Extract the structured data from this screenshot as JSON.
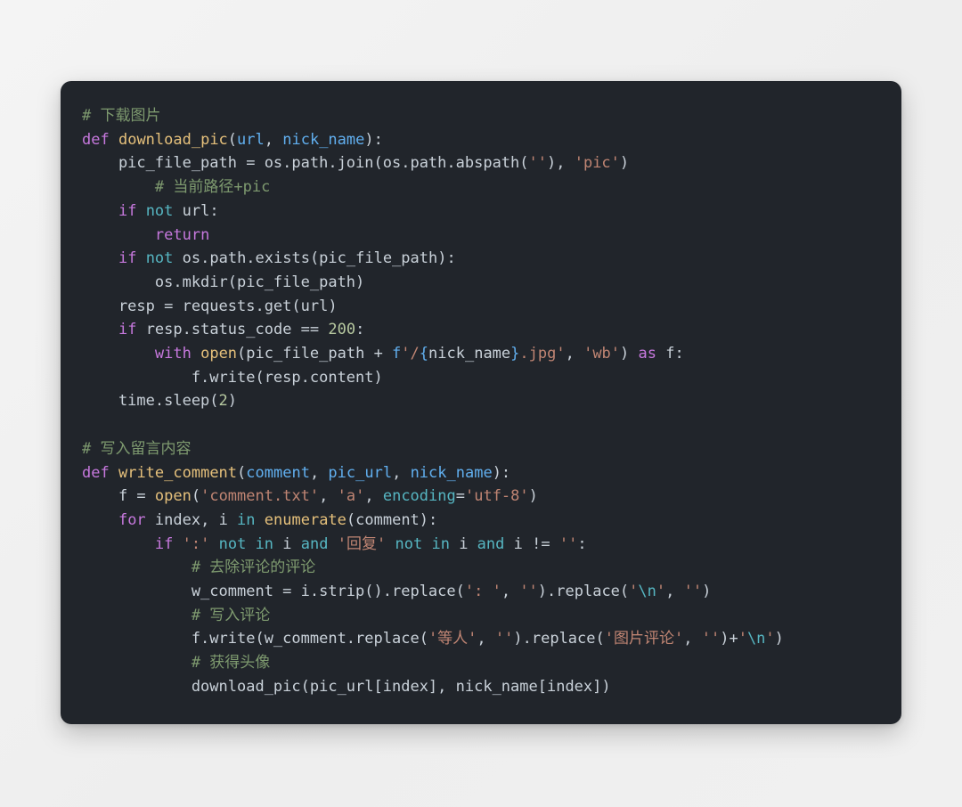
{
  "meta": {
    "background_color": "#f2f2f2",
    "card_color": "#21252b",
    "language": "python"
  },
  "theme": {
    "comment": "#7e9a6f",
    "keyword": "#c678dd",
    "operator_keyword": "#56b6c2",
    "function": "#e5c07b",
    "parameter": "#61afef",
    "string": "#c08573",
    "number": "#b7c9a0",
    "escape": "#56b6c2",
    "plain": "#c9d1d9"
  },
  "code": {
    "lines": [
      "# 下载图片",
      "def download_pic(url, nick_name):",
      "    pic_file_path = os.path.join(os.path.abspath(''), 'pic')",
      "    # 当前路径+pic",
      "    if not url:",
      "        return",
      "    if not os.path.exists(pic_file_path):",
      "        os.mkdir(pic_file_path)",
      "    resp = requests.get(url)",
      "    if resp.status_code == 200:",
      "        with open(pic_file_path + f'/{nick_name}.jpg', 'wb') as f:",
      "            f.write(resp.content)",
      "    time.sleep(2)",
      "",
      "# 写入留言内容",
      "def write_comment(comment, pic_url, nick_name):",
      "    f = open('comment.txt', 'a', encoding='utf-8')",
      "    for index, i in enumerate(comment):",
      "        if ':' not in i and '回复' not in i and i != '':",
      "            # 去除评论的评论",
      "            w_comment = i.strip().replace(': ', '').replace('\\n', '')",
      "            # 写入评论",
      "            f.write(w_comment.replace('等人', '').replace('图片评论', '')+'\\n')",
      "            # 获得头像",
      "            download_pic(pic_url[index], nick_name[index])"
    ],
    "tokens": {
      "comments": [
        "# 下载图片",
        "# 当前路径+pic",
        "# 写入留言内容",
        "# 去除评论的评论",
        "# 写入评论",
        "# 获得头像"
      ],
      "keywords": [
        "def",
        "if",
        "not",
        "return",
        "with",
        "as",
        "for",
        "in",
        "and"
      ],
      "functions": [
        "download_pic",
        "write_comment",
        "open",
        "enumerate"
      ],
      "strings": [
        "''",
        "'pic'",
        "'/{nick_name}.jpg'",
        "'wb'",
        "'comment.txt'",
        "'a'",
        "'utf-8'",
        "':'",
        "'回复'",
        "': '",
        "'\\n'",
        "'等人'",
        "'图片评论'"
      ],
      "numbers": [
        "200",
        "2"
      ],
      "identifiers": [
        "pic_file_path",
        "url",
        "nick_name",
        "os.path.join",
        "os.path.abspath",
        "os.path.exists",
        "os.mkdir",
        "resp",
        "requests.get",
        "resp.status_code",
        "f.write",
        "resp.content",
        "time.sleep",
        "comment",
        "pic_url",
        "encoding",
        "index",
        "i",
        "i.strip",
        "replace",
        "w_comment"
      ]
    }
  }
}
